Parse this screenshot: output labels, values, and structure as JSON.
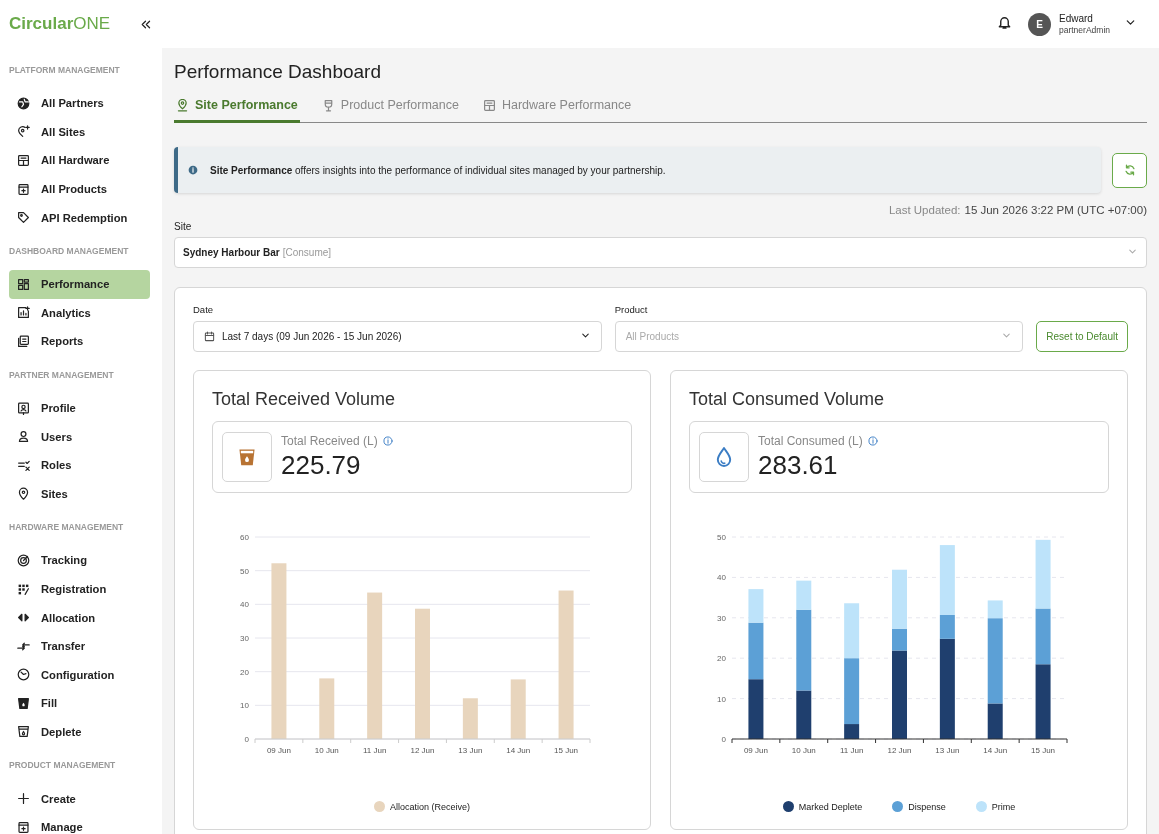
{
  "header": {
    "logo": "**Circular**ONE",
    "user": {
      "initial": "E",
      "name": "Edward",
      "role": "partnerAdmin"
    }
  },
  "sidebar": {
    "sections": [
      {
        "title": "PLATFORM MANAGEMENT",
        "items": [
          {
            "label": "All Partners",
            "selected": false
          },
          {
            "label": "All Sites",
            "selected": false
          },
          {
            "label": "All Hardware",
            "selected": false
          },
          {
            "label": "All Products",
            "selected": false
          },
          {
            "label": "API Redemption",
            "selected": false
          }
        ]
      },
      {
        "title": "DASHBOARD MANAGEMENT",
        "items": [
          {
            "label": "Performance",
            "selected": true
          },
          {
            "label": "Analytics",
            "selected": false
          },
          {
            "label": "Reports",
            "selected": false
          }
        ]
      },
      {
        "title": "PARTNER MANAGEMENT",
        "items": [
          {
            "label": "Profile",
            "selected": false
          },
          {
            "label": "Users",
            "selected": false
          },
          {
            "label": "Roles",
            "selected": false
          },
          {
            "label": "Sites",
            "selected": false
          }
        ]
      },
      {
        "title": "HARDWARE MANAGEMENT",
        "items": [
          {
            "label": "Tracking",
            "selected": false
          },
          {
            "label": "Registration",
            "selected": false
          },
          {
            "label": "Allocation",
            "selected": false
          },
          {
            "label": "Transfer",
            "selected": false
          },
          {
            "label": "Configuration",
            "selected": false
          },
          {
            "label": "Fill",
            "selected": false
          },
          {
            "label": "Deplete",
            "selected": false
          }
        ]
      },
      {
        "title": "PRODUCT MANAGEMENT",
        "items": [
          {
            "label": "Create",
            "selected": false
          },
          {
            "label": "Manage",
            "selected": false
          }
        ]
      }
    ]
  },
  "page": {
    "title": "Performance Dashboard",
    "tabs": [
      {
        "label": "Site Performance",
        "selected": true
      },
      {
        "label": "Product Performance",
        "selected": false
      },
      {
        "label": "Hardware Performance",
        "selected": false
      }
    ],
    "banner": "**Site Performance** offers insights into the performance of individual sites managed by your partnership.",
    "last_updated": {
      "label": "Last Updated:",
      "value": "15 Jun 2026 3:22 PM (UTC +07:00)"
    },
    "site": {
      "label": "Site",
      "value": "Sydney Harbour Bar",
      "tag": "[Consume]"
    },
    "filters": {
      "date": {
        "label": "Date",
        "value": "Last 7 days (09 Jun 2026 - 15 Jun 2026)"
      },
      "product": {
        "label": "Product",
        "placeholder": "All Products"
      },
      "reset": "Reset to Default"
    },
    "cards": [
      {
        "title": "Total Received Volume",
        "stat_label": "Total Received (L)",
        "stat_value": "225.79",
        "chart_data": {
          "type": "bar",
          "categories": [
            "09 Jun",
            "10 Jun",
            "11 Jun",
            "12 Jun",
            "13 Jun",
            "14 Jun",
            "15 Jun"
          ],
          "ylim": [
            0,
            60
          ],
          "yticks": [
            0,
            10,
            20,
            30,
            40,
            50,
            60
          ],
          "stacked": false,
          "grid": true,
          "legend": "bottom",
          "series": [
            {
              "name": "Allocation (Receive)",
              "color": "#e8d5bd",
              "values": [
                52.2,
                18,
                43.5,
                38.7,
                12.1,
                17.7,
                44.1
              ]
            }
          ]
        }
      },
      {
        "title": "Total Consumed Volume",
        "stat_label": "Total Consumed (L)",
        "stat_value": "283.61",
        "chart_data": {
          "type": "bar",
          "categories": [
            "09 Jun",
            "10 Jun",
            "11 Jun",
            "12 Jun",
            "13 Jun",
            "14 Jun",
            "15 Jun"
          ],
          "ylim": [
            0,
            50
          ],
          "yticks": [
            0,
            10,
            20,
            30,
            40,
            50
          ],
          "stacked": true,
          "grid": true,
          "legend": "bottom",
          "series": [
            {
              "name": "Marked Deplete",
              "color": "#1f3f6e",
              "values": [
                14.8,
                12,
                3.7,
                21.9,
                24.8,
                8.8,
                18.5
              ]
            },
            {
              "name": "Dispense",
              "color": "#5ca0d6",
              "values": [
                14,
                20,
                16.3,
                5.4,
                5.9,
                21.1,
                13.8
              ]
            },
            {
              "name": "Prime",
              "color": "#bde3fa",
              "values": [
                8.3,
                7.2,
                13.6,
                14.6,
                17.3,
                4.4,
                17
              ]
            }
          ]
        }
      }
    ]
  }
}
